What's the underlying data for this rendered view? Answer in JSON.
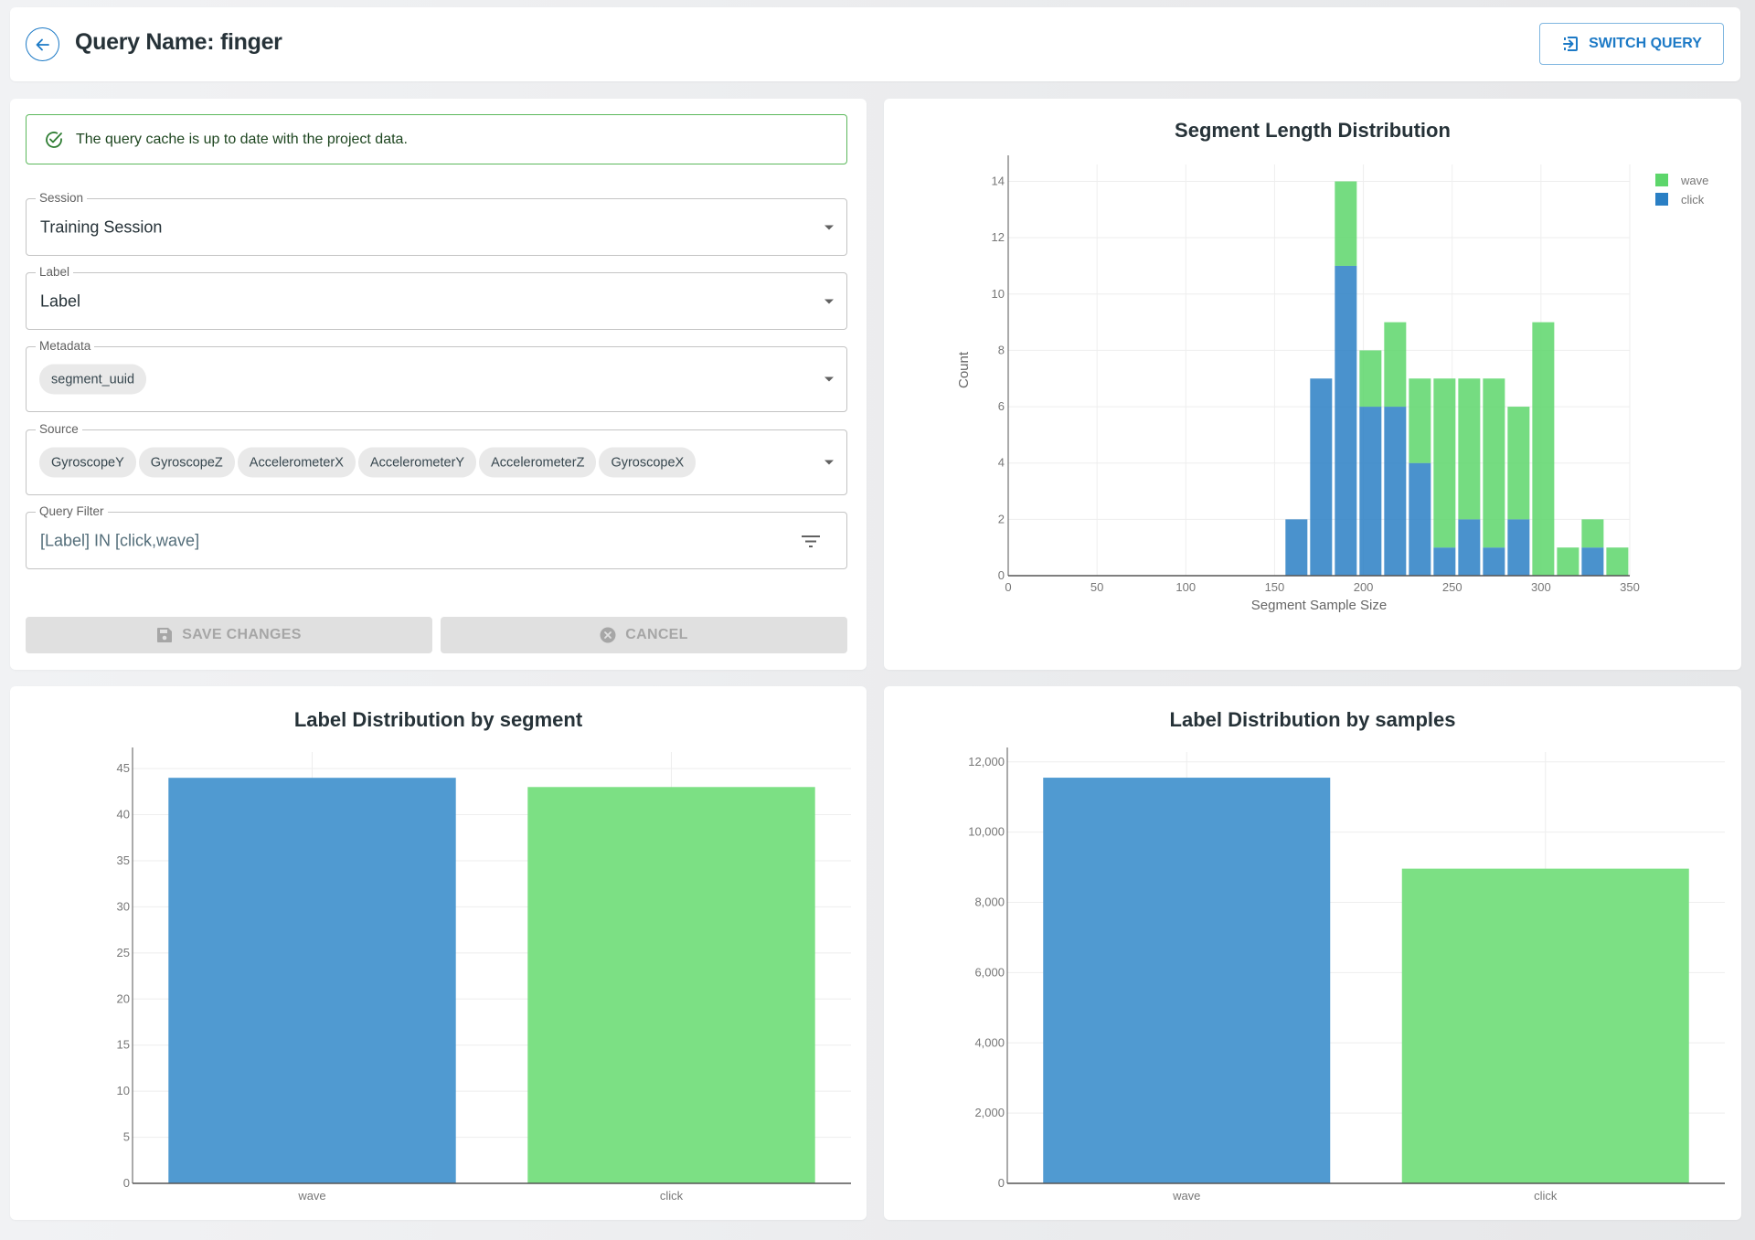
{
  "header": {
    "title": "Query Name: finger",
    "back_icon": "arrow-left-circle-icon",
    "switch_button": {
      "label": "SWITCH QUERY",
      "icon": "switch-icon"
    }
  },
  "colors": {
    "primary": "#1d7ac6",
    "wave_hist": "#5dd66b",
    "click_hist": "#2a7fc4",
    "bar_blue": "#4a97cf",
    "bar_green": "#78df80",
    "success_border": "#5cb85c",
    "success_text": "#1e4620"
  },
  "form": {
    "alert": {
      "icon": "check-circle-icon",
      "text": "The query cache is up to date with the project data."
    },
    "session": {
      "label": "Session",
      "value": "Training Session"
    },
    "label_field": {
      "label": "Label",
      "value": "Label"
    },
    "metadata": {
      "label": "Metadata",
      "chips": [
        "segment_uuid"
      ]
    },
    "source": {
      "label": "Source",
      "chips": [
        "GyroscopeY",
        "GyroscopeZ",
        "AccelerometerX",
        "AccelerometerY",
        "AccelerometerZ",
        "GyroscopeX"
      ]
    },
    "query_filter": {
      "label": "Query Filter",
      "value": "[Label] IN [click,wave]",
      "icon": "filter-icon"
    },
    "save_button": {
      "label": "SAVE CHANGES",
      "icon": "save-icon",
      "disabled": true
    },
    "cancel_button": {
      "label": "CANCEL",
      "icon": "cancel-circle-icon",
      "disabled": true
    }
  },
  "chart_data": [
    {
      "id": "segment-length",
      "type": "bar",
      "stacked": true,
      "title": "Segment Length Distribution",
      "xlabel": "Segment Sample Size",
      "ylabel": "Count",
      "xlim": [
        0,
        350
      ],
      "ylim": [
        0,
        14.6
      ],
      "xticks": [
        0,
        50,
        100,
        150,
        200,
        250,
        300,
        350
      ],
      "yticks": [
        0,
        2,
        4,
        6,
        8,
        10,
        12,
        14
      ],
      "grid": true,
      "legend_position": "top-right",
      "bin_start": 155.6,
      "bin_width": 13.9,
      "series": [
        {
          "name": "click",
          "color": "#2a7fc4",
          "values": [
            2,
            7,
            11,
            6,
            6,
            4,
            1,
            2,
            1,
            2,
            0,
            0,
            1,
            0
          ]
        },
        {
          "name": "wave",
          "color": "#5dd66b",
          "values": [
            0,
            0,
            3,
            2,
            3,
            3,
            6,
            5,
            6,
            4,
            9,
            1,
            1,
            1
          ]
        }
      ],
      "legend": [
        {
          "name": "wave",
          "color": "#5dd66b"
        },
        {
          "name": "click",
          "color": "#2a7fc4"
        }
      ]
    },
    {
      "id": "label-segment",
      "type": "bar",
      "title": "Label Distribution by segment",
      "xlabel": "",
      "ylabel": "",
      "categories": [
        "wave",
        "click"
      ],
      "values": [
        44,
        43
      ],
      "colors": [
        "#4a97cf",
        "#78df80"
      ],
      "ylim": [
        0,
        46.3
      ],
      "yticks": [
        0,
        5,
        10,
        15,
        20,
        25,
        30,
        35,
        40,
        45
      ],
      "ytick_labels": [
        "0",
        "5",
        "10",
        "15",
        "20",
        "25",
        "30",
        "35",
        "40",
        "45"
      ],
      "grid": true
    },
    {
      "id": "label-samples",
      "type": "bar",
      "title": "Label Distribution by samples",
      "xlabel": "",
      "ylabel": "",
      "categories": [
        "wave",
        "click"
      ],
      "values": [
        11550,
        8960
      ],
      "colors": [
        "#4a97cf",
        "#78df80"
      ],
      "ylim": [
        0,
        12150
      ],
      "yticks": [
        0,
        2000,
        4000,
        6000,
        8000,
        10000,
        12000
      ],
      "ytick_labels": [
        "0",
        "2,000",
        "4,000",
        "6,000",
        "8,000",
        "10,000",
        "12,000"
      ],
      "grid": true
    }
  ]
}
